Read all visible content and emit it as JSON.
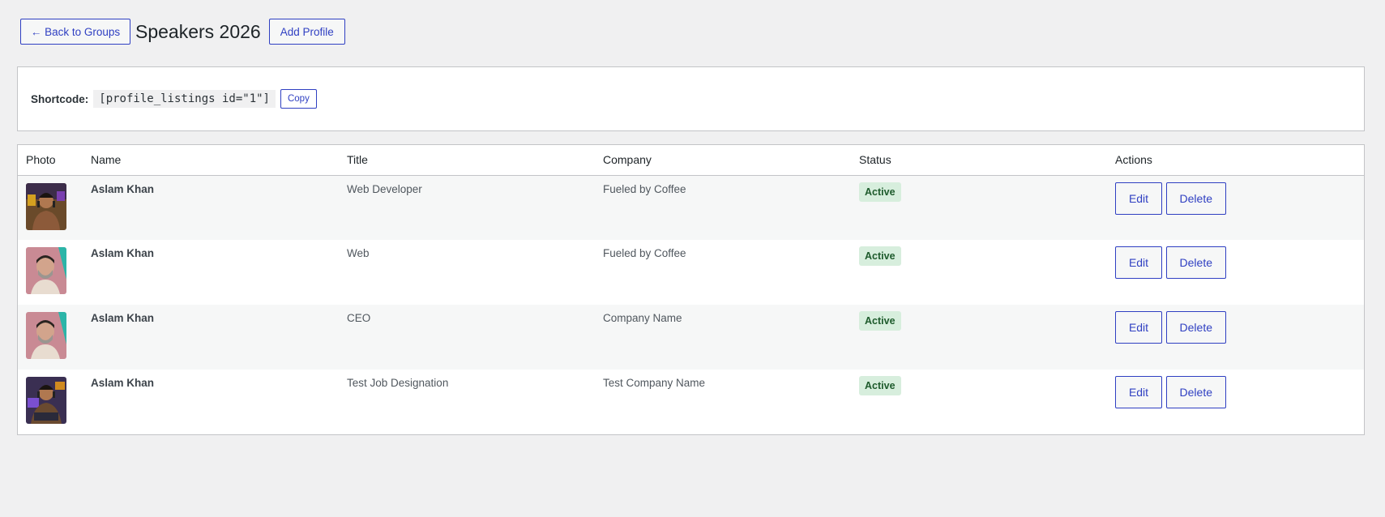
{
  "header": {
    "back_label": "← Back to Groups",
    "title": "Speakers 2026",
    "add_label": "Add Profile"
  },
  "shortcode": {
    "label": "Shortcode:",
    "code": "[profile_listings id=\"1\"]",
    "copy_label": "Copy"
  },
  "table": {
    "columns": [
      "Photo",
      "Name",
      "Title",
      "Company",
      "Status",
      "Actions"
    ],
    "rows": [
      {
        "name": "Aslam Khan",
        "title": "Web Developer",
        "company": "Fueled by Coffee",
        "status": "Active",
        "edit": "Edit",
        "delete": "Delete"
      },
      {
        "name": "Aslam Khan",
        "title": "Web",
        "company": "Fueled by Coffee",
        "status": "Active",
        "edit": "Edit",
        "delete": "Delete"
      },
      {
        "name": "Aslam Khan",
        "title": "CEO",
        "company": "Company Name",
        "status": "Active",
        "edit": "Edit",
        "delete": "Delete"
      },
      {
        "name": "Aslam Khan",
        "title": "Test Job Designation",
        "company": "Test Company Name",
        "status": "Active",
        "edit": "Edit",
        "delete": "Delete"
      }
    ]
  },
  "colors": {
    "accent": "#2f3fc2",
    "badge_bg": "#d7eedd",
    "badge_text": "#1e5b2c",
    "page_bg": "#f0f0f1"
  }
}
